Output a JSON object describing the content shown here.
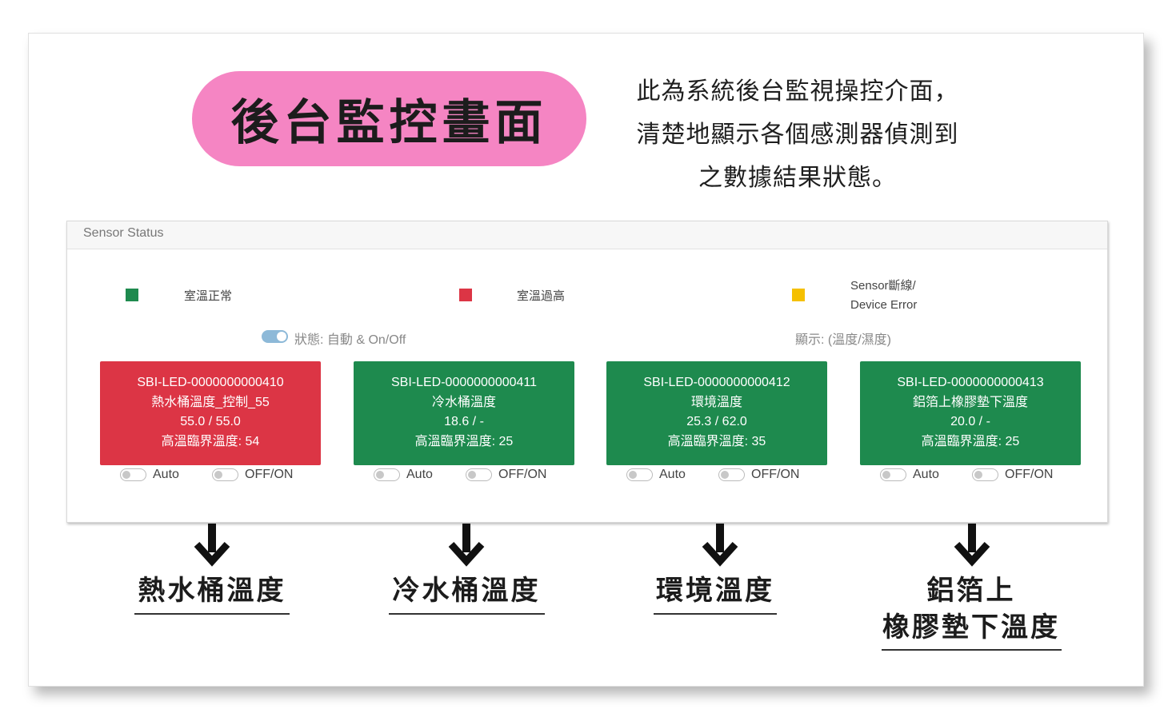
{
  "title": "後台監控畫面",
  "description": [
    "此為系統後台監視操控介面，",
    "清楚地顯示各個感測器偵測到",
    "之數據結果狀態。"
  ],
  "panel": {
    "header": "Sensor Status",
    "legend": [
      {
        "label": "室溫正常",
        "color": "#1e8a4e"
      },
      {
        "label": "室溫過高",
        "color": "#dc3545"
      },
      {
        "label_line1": "Sensor斷線/",
        "label_line2": "Device Error",
        "color": "#f5c000"
      }
    ],
    "status_toggle_label": "狀態: 自動 & On/Off",
    "display_label": "顯示: (溫度/濕度)",
    "cards": [
      {
        "id": "SBI-LED-0000000000410",
        "name": "熱水桶溫度_控制_55",
        "reading": "55.0 / 55.0",
        "threshold": "高溫臨界溫度: 54",
        "status": "red"
      },
      {
        "id": "SBI-LED-0000000000411",
        "name": "冷水桶溫度",
        "reading": "18.6 / -",
        "threshold": "高溫臨界溫度: 25",
        "status": "green"
      },
      {
        "id": "SBI-LED-0000000000412",
        "name": "環境溫度",
        "reading": "25.3 / 62.0",
        "threshold": "高溫臨界溫度: 35",
        "status": "green"
      },
      {
        "id": "SBI-LED-0000000000413",
        "name": "鋁箔上橡膠墊下溫度",
        "reading": "20.0 / -",
        "threshold": "高溫臨界溫度: 25",
        "status": "green"
      }
    ],
    "auto_label": "Auto",
    "offon_label": "OFF/ON"
  },
  "bottom_labels": [
    {
      "line1": "熱水桶溫度"
    },
    {
      "line1": "冷水桶溫度"
    },
    {
      "line1": "環境溫度"
    },
    {
      "line1": "鋁箔上",
      "line2": "橡膠墊下溫度"
    }
  ]
}
